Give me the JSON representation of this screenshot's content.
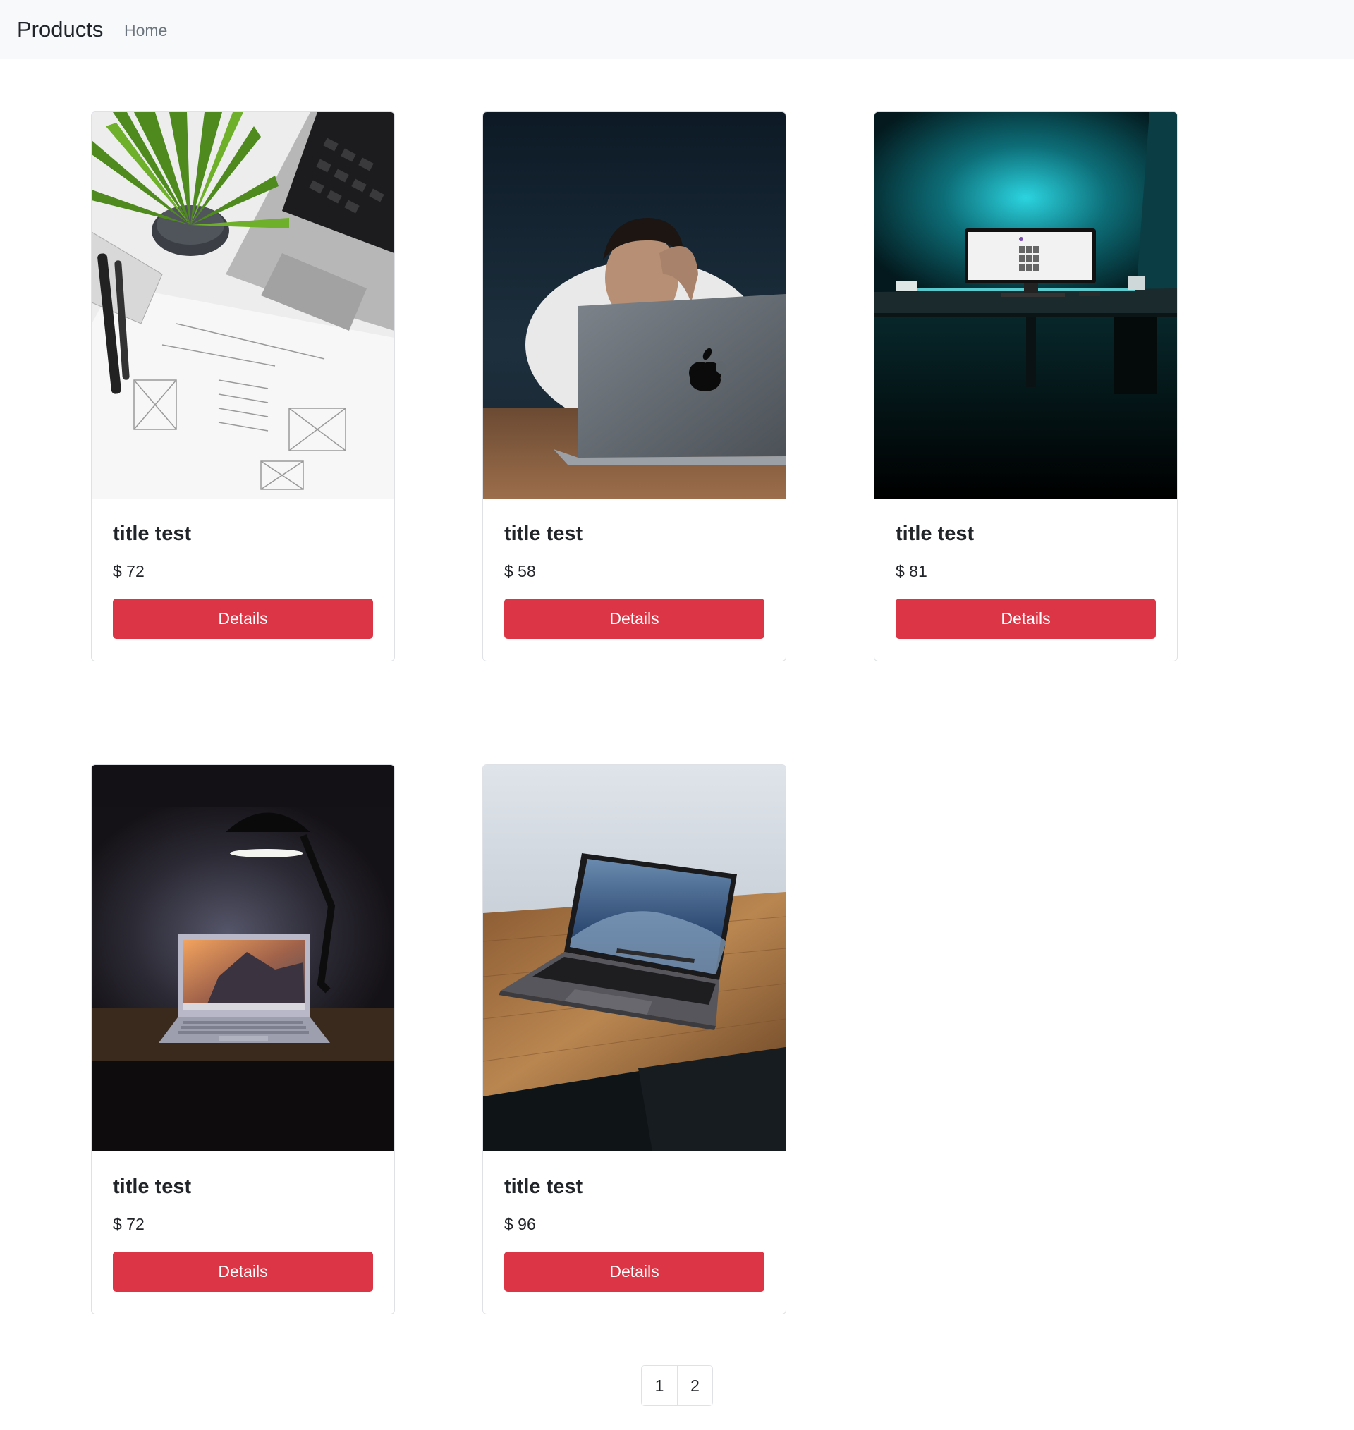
{
  "navbar": {
    "brand": "Products",
    "links": [
      {
        "label": "Home"
      }
    ]
  },
  "colors": {
    "navbar_bg": "#f8f9fa",
    "button_bg": "#dc3545",
    "button_text": "#ffffff",
    "card_border": "#dee2e6",
    "muted_link": "#6c757d"
  },
  "products": [
    {
      "title": "title test",
      "price": "$ 72",
      "button": "Details"
    },
    {
      "title": "title test",
      "price": "$ 58",
      "button": "Details"
    },
    {
      "title": "title test",
      "price": "$ 81",
      "button": "Details"
    },
    {
      "title": "title test",
      "price": "$ 72",
      "button": "Details"
    },
    {
      "title": "title test",
      "price": "$ 96",
      "button": "Details"
    }
  ],
  "pagination": {
    "pages": [
      "1",
      "2"
    ]
  }
}
